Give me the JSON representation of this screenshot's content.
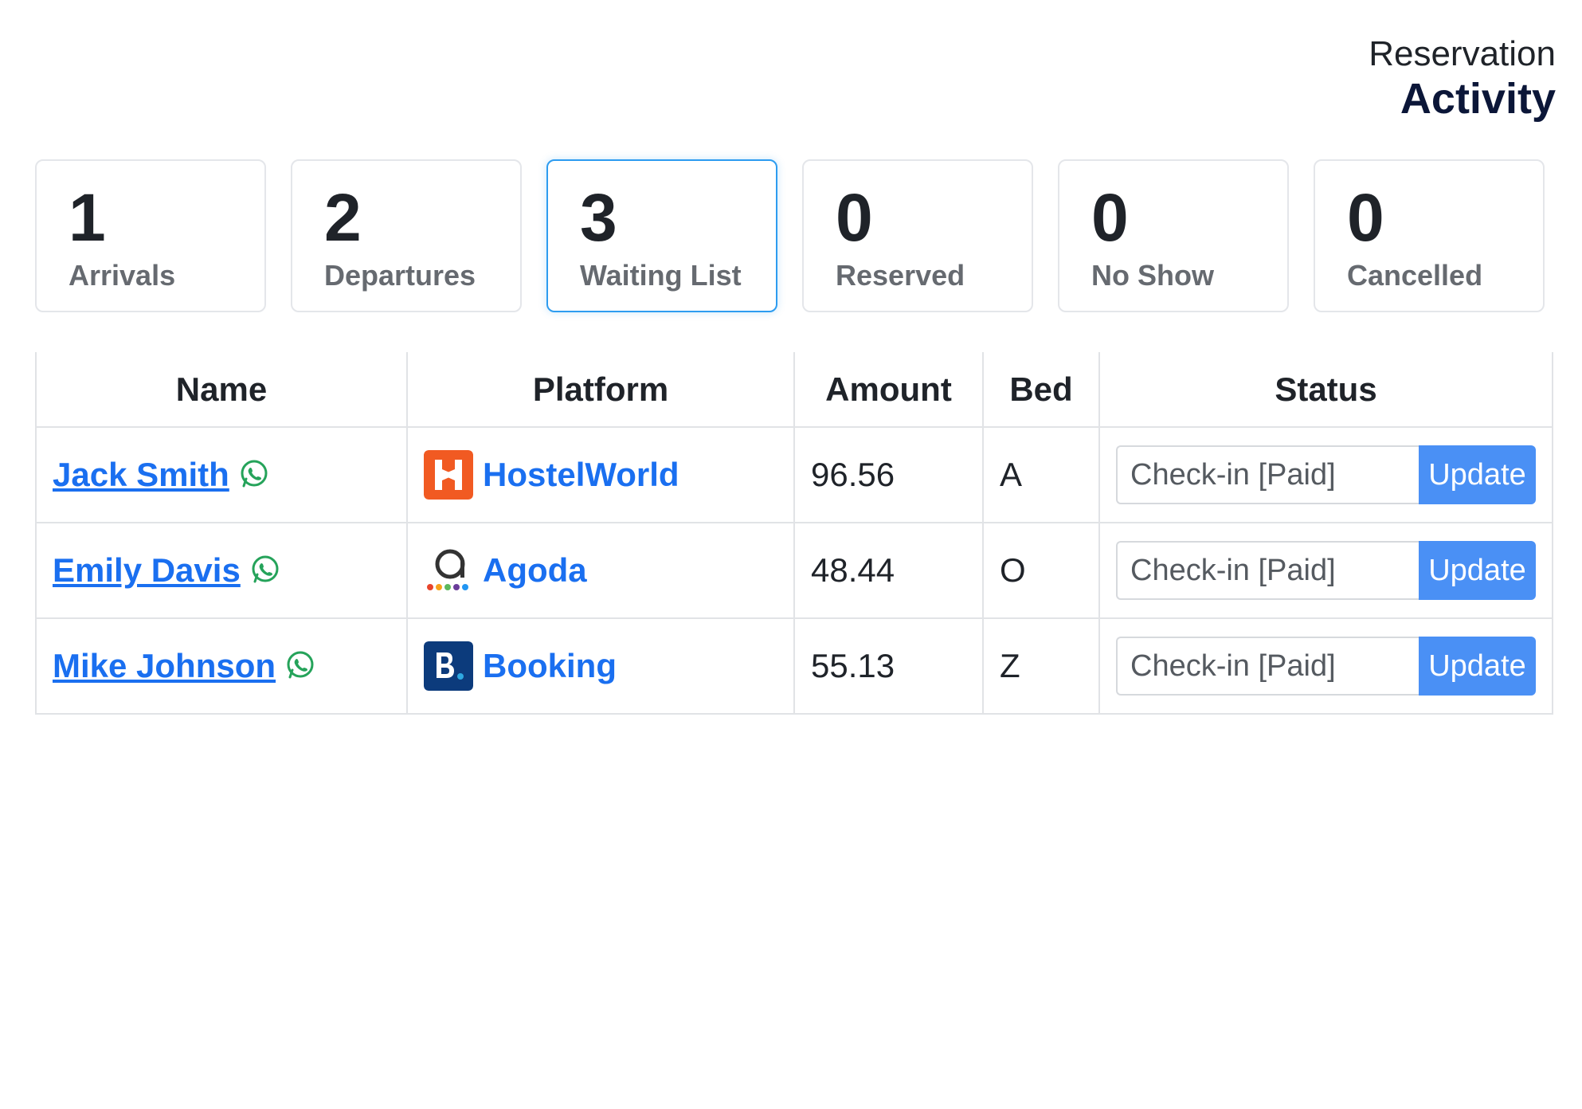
{
  "header": {
    "subtitle": "Reservation",
    "title": "Activity"
  },
  "cards": [
    {
      "count": "1",
      "label": "Arrivals"
    },
    {
      "count": "2",
      "label": "Departures"
    },
    {
      "count": "3",
      "label": "Waiting List"
    },
    {
      "count": "0",
      "label": "Reserved"
    },
    {
      "count": "0",
      "label": "No Show"
    },
    {
      "count": "0",
      "label": "Cancelled"
    }
  ],
  "active_card_index": 2,
  "table": {
    "headers": [
      "Name",
      "Platform",
      "Amount",
      "Bed",
      "Status"
    ],
    "rows": [
      {
        "name": "Jack Smith",
        "platform": "HostelWorld",
        "amount": "96.56",
        "bed": "A",
        "status": "Check-in [Paid]",
        "action": "Update"
      },
      {
        "name": "Emily Davis",
        "platform": "Agoda",
        "amount": "48.44",
        "bed": "O",
        "status": "Check-in [Paid]",
        "action": "Update"
      },
      {
        "name": "Mike Johnson",
        "platform": "Booking",
        "amount": "55.13",
        "bed": "Z",
        "status": "Check-in [Paid]",
        "action": "Update"
      }
    ]
  },
  "icons": {
    "contact": "whatsapp-icon",
    "platforms": [
      "hostelworld-logo-icon",
      "agoda-logo-icon",
      "booking-logo-icon"
    ]
  },
  "colors": {
    "link": "#1a6ff0",
    "button": "#4a90f5",
    "active_card_border": "#2d9cf0",
    "whatsapp": "#25a35a",
    "hostelworld": "#f15a22",
    "booking": "#0c3b7c"
  }
}
